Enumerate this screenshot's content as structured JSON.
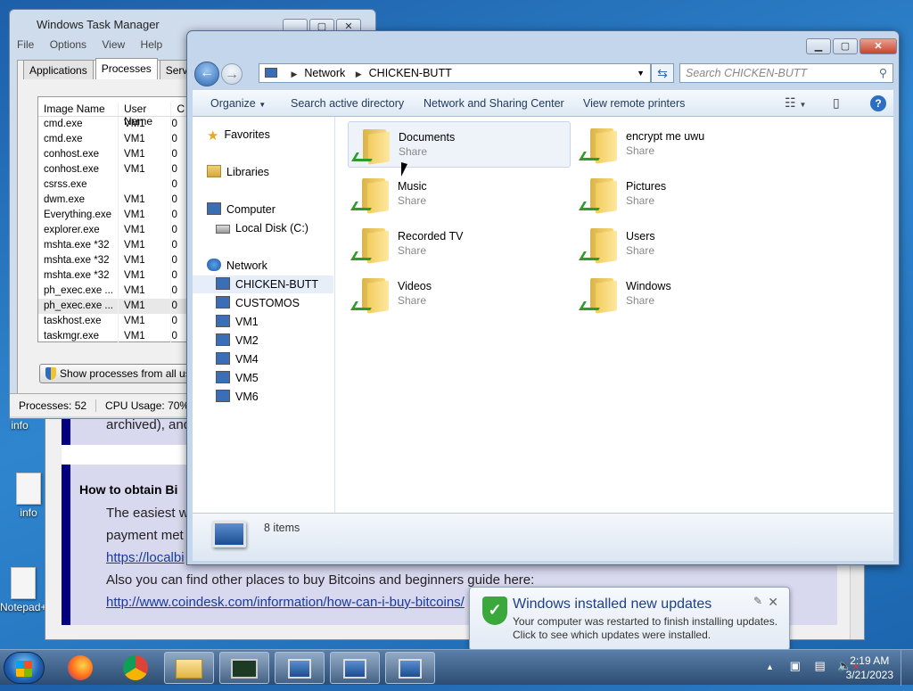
{
  "desktop": {
    "icons": [
      {
        "label": "info",
        "top": 0
      },
      {
        "label": "info",
        "top": 0
      },
      {
        "label": "Notepad+",
        "top": 0
      }
    ]
  },
  "browser": {
    "archived_text": "archived), and",
    "how_to_heading": "How to obtain Bi",
    "easiest_text": "The easiest w",
    "payment_text": "payment met",
    "local_link": "https://localbi",
    "also_text": "Also you can find other places to buy Bitcoins and beginners guide here:",
    "coindesk_link": "http://www.coindesk.com/information/how-can-i-buy-bitcoins/"
  },
  "task_manager": {
    "title": "Windows Task Manager",
    "menu": [
      "File",
      "Options",
      "View",
      "Help"
    ],
    "tabs": [
      "Applications",
      "Processes",
      "Services"
    ],
    "columns": [
      "Image Name",
      "User Name",
      "C"
    ],
    "rows": [
      {
        "image": "cmd.exe",
        "user": "VM1",
        "c": "0"
      },
      {
        "image": "cmd.exe",
        "user": "VM1",
        "c": "0"
      },
      {
        "image": "conhost.exe",
        "user": "VM1",
        "c": "0"
      },
      {
        "image": "conhost.exe",
        "user": "VM1",
        "c": "0"
      },
      {
        "image": "csrss.exe",
        "user": "",
        "c": "0"
      },
      {
        "image": "dwm.exe",
        "user": "VM1",
        "c": "0"
      },
      {
        "image": "Everything.exe",
        "user": "VM1",
        "c": "0"
      },
      {
        "image": "explorer.exe",
        "user": "VM1",
        "c": "0"
      },
      {
        "image": "mshta.exe *32",
        "user": "VM1",
        "c": "0"
      },
      {
        "image": "mshta.exe *32",
        "user": "VM1",
        "c": "0"
      },
      {
        "image": "mshta.exe *32",
        "user": "VM1",
        "c": "0"
      },
      {
        "image": "ph_exec.exe ...",
        "user": "VM1",
        "c": "0"
      },
      {
        "image": "ph_exec.exe ...",
        "user": "VM1",
        "c": "0"
      },
      {
        "image": "taskhost.exe",
        "user": "VM1",
        "c": "0"
      },
      {
        "image": "taskmgr.exe",
        "user": "VM1",
        "c": "0"
      }
    ],
    "show_all_button": "Show processes from all users",
    "status_processes": "Processes: 52",
    "status_cpu": "CPU Usage: 70%"
  },
  "explorer": {
    "breadcrumb": [
      "Network",
      "CHICKEN-BUTT"
    ],
    "search_placeholder": "Search CHICKEN-BUTT",
    "commands": [
      "Organize",
      "Search active directory",
      "Network and Sharing Center",
      "View remote printers"
    ],
    "nav": {
      "favorites": "Favorites",
      "libraries": "Libraries",
      "computer": "Computer",
      "local_disk": "Local Disk (C:)",
      "network": "Network",
      "hosts": [
        "CHICKEN-BUTT",
        "CUSTOMOS",
        "VM1",
        "VM2",
        "VM4",
        "VM5",
        "VM6"
      ]
    },
    "shares": [
      {
        "name": "Documents",
        "type": "Share"
      },
      {
        "name": "encrypt me uwu",
        "type": "Share"
      },
      {
        "name": "Music",
        "type": "Share"
      },
      {
        "name": "Pictures",
        "type": "Share"
      },
      {
        "name": "Recorded TV",
        "type": "Share"
      },
      {
        "name": "Users",
        "type": "Share"
      },
      {
        "name": "Videos",
        "type": "Share"
      },
      {
        "name": "Windows",
        "type": "Share"
      }
    ],
    "item_count": "8 items"
  },
  "notification": {
    "title": "Windows installed new updates",
    "line1": "Your computer was restarted to finish installing updates.",
    "line2": "Click to see which updates were installed."
  },
  "taskbar": {
    "time": "2:19 AM",
    "date": "3/21/2023"
  },
  "colors": {
    "accent": "#1e3f8a",
    "selection": "#e5eef9",
    "share_green": "#2c9c2c"
  }
}
